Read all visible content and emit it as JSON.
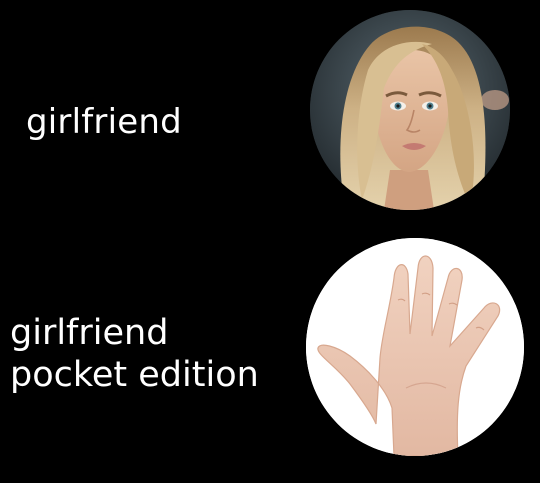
{
  "top_panel": {
    "caption": "girlfriend",
    "photo_subject": "woman-portrait"
  },
  "bottom_panel": {
    "caption_line1": "girlfriend",
    "caption_line2": "pocket edition",
    "photo_subject": "open-hand"
  }
}
